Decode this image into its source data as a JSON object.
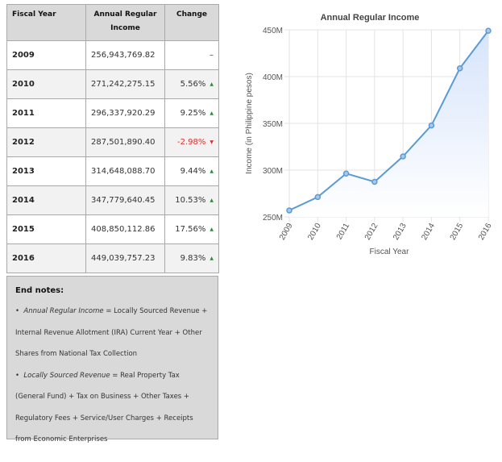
{
  "table": {
    "headers": {
      "year": "Fiscal Year",
      "income": "Annual Regular Income",
      "change": "Change"
    },
    "rows": [
      {
        "year": "2009",
        "income": "256,943,769.82",
        "change": "–",
        "direction": "none"
      },
      {
        "year": "2010",
        "income": "271,242,275.15",
        "change": "5.56%",
        "direction": "up"
      },
      {
        "year": "2011",
        "income": "296,337,920.29",
        "change": "9.25%",
        "direction": "up"
      },
      {
        "year": "2012",
        "income": "287,501,890.40",
        "change": "-2.98%",
        "direction": "down"
      },
      {
        "year": "2013",
        "income": "314,648,088.70",
        "change": "9.44%",
        "direction": "up"
      },
      {
        "year": "2014",
        "income": "347,779,640.45",
        "change": "10.53%",
        "direction": "up"
      },
      {
        "year": "2015",
        "income": "408,850,112.86",
        "change": "17.56%",
        "direction": "up"
      },
      {
        "year": "2016",
        "income": "449,039,757.23",
        "change": "9.83%",
        "direction": "up"
      }
    ]
  },
  "notes": {
    "title": "End notes:",
    "items": [
      {
        "term": "Annual Regular Income",
        "definition": " = Locally Sourced Revenue + Internal Revenue Allotment (IRA) Current Year + Other Shares from National Tax Collection"
      },
      {
        "term": "Locally Sourced Revenue",
        "definition": " = Real Property Tax (General Fund) + Tax on Business + Other Taxes + Regulatory Fees + Service/User Charges + Receipts from Economic Enterprises"
      }
    ]
  },
  "chart_data": {
    "type": "area",
    "title": "Annual Regular Income",
    "xlabel": "Fiscal Year",
    "ylabel": "Income (in Philippine pesos)",
    "x": [
      "2009",
      "2010",
      "2011",
      "2012",
      "2013",
      "2014",
      "2015",
      "2016"
    ],
    "values": [
      256943769.82,
      271242275.15,
      296337920.29,
      287501890.4,
      314648088.7,
      347779640.45,
      408850112.86,
      449039757.23
    ],
    "ylim": [
      250000000,
      450000000
    ],
    "yticks": [
      250000000,
      300000000,
      350000000,
      400000000,
      450000000
    ],
    "ytick_labels": [
      "250M",
      "300M",
      "350M",
      "400M",
      "450M"
    ],
    "grid": true,
    "legend": "none",
    "colors": {
      "line": "#5b9bd5",
      "fill_top": "#d6e4fb",
      "fill_bottom": "#ffffff",
      "point": "#5b9bd5",
      "grid": "#e3e3e3"
    }
  }
}
